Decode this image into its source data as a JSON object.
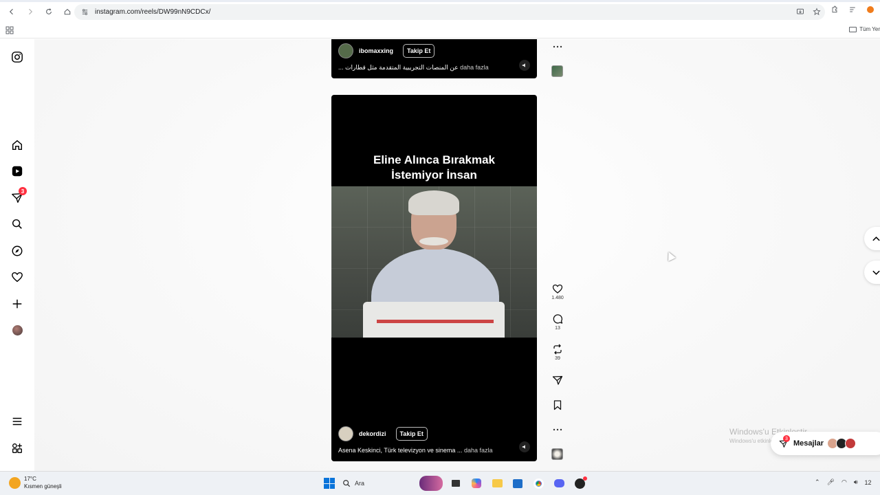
{
  "browser": {
    "url": "instagram.com/reels/DW99nN9CDCx/",
    "bookmarks_label": "Tüm Yer"
  },
  "sidebar": {
    "notifications_badge": "3"
  },
  "reels": {
    "top": {
      "username": "ibomaxxing",
      "follow_label": "Takip Et",
      "caption": "‫عن المنصات التجريبية المتقدمة مثل قطارات ...‬",
      "caption_more": "daha fazla"
    },
    "main": {
      "headline_line1": "Eline Alınca Bırakmak",
      "headline_line2": "İstemiyor İnsan",
      "username": "dekordizi",
      "follow_label": "Takip Et",
      "caption": "Asena Keskinci, Türk televizyon ve sinema ...",
      "caption_more": "daha fazla"
    }
  },
  "actions": {
    "likes": "1.480",
    "comments": "13",
    "reposts": "39"
  },
  "watermark": {
    "title": "Windows'u Etkinleştir",
    "subtitle": "Windows'u etkinleştirmek için Ayarlar'a gidin."
  },
  "messages": {
    "label": "Mesajlar",
    "badge": "3"
  },
  "taskbar": {
    "temperature": "17°C",
    "weather": "Kısmen güneşli",
    "search_placeholder": "Ara",
    "clock": "12"
  },
  "colors": {
    "badge_red": "#ff3040",
    "windows_blue": "#0a74da"
  }
}
